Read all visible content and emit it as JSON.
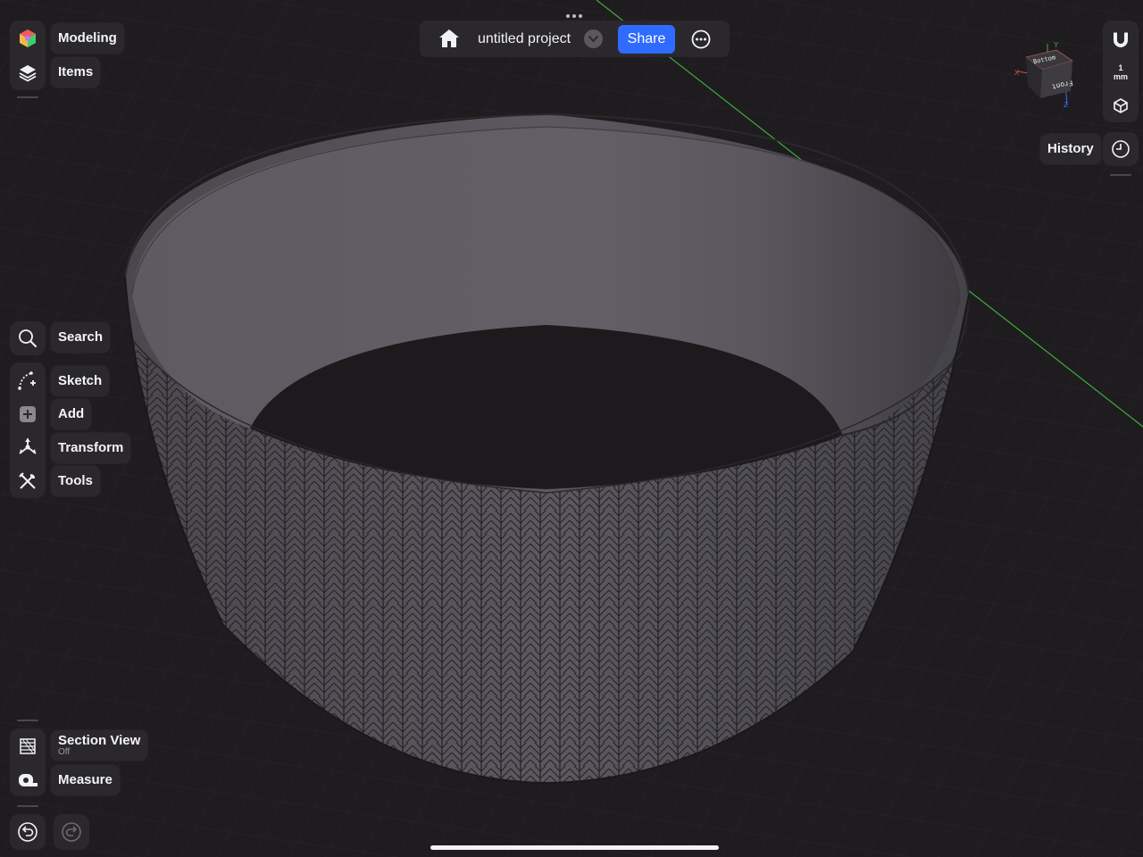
{
  "topbar": {
    "project_title": "untitled project",
    "share_label": "Share",
    "icons": [
      "home-icon",
      "chevron-down-icon",
      "more-icon"
    ]
  },
  "left_panel": {
    "modeling_label": "Modeling",
    "items_label": "Items",
    "search_label": "Search",
    "sketch_label": "Sketch",
    "add_label": "Add",
    "transform_label": "Transform",
    "tools_label": "Tools",
    "section_view_label": "Section View",
    "section_view_state": "Off",
    "measure_label": "Measure"
  },
  "right_panel": {
    "history_label": "History",
    "snap_value": "1",
    "snap_unit": "mm"
  },
  "view_cube": {
    "top_face": "Bottom",
    "front_face": "Front",
    "axis_x": "X",
    "axis_y": "Y",
    "axis_z": "Z"
  },
  "colors": {
    "background": "#1e1c1f",
    "panel": "#2a282c",
    "accent": "#2f6bff",
    "model": "#5a585e",
    "axis_green": "#3fae3a"
  }
}
